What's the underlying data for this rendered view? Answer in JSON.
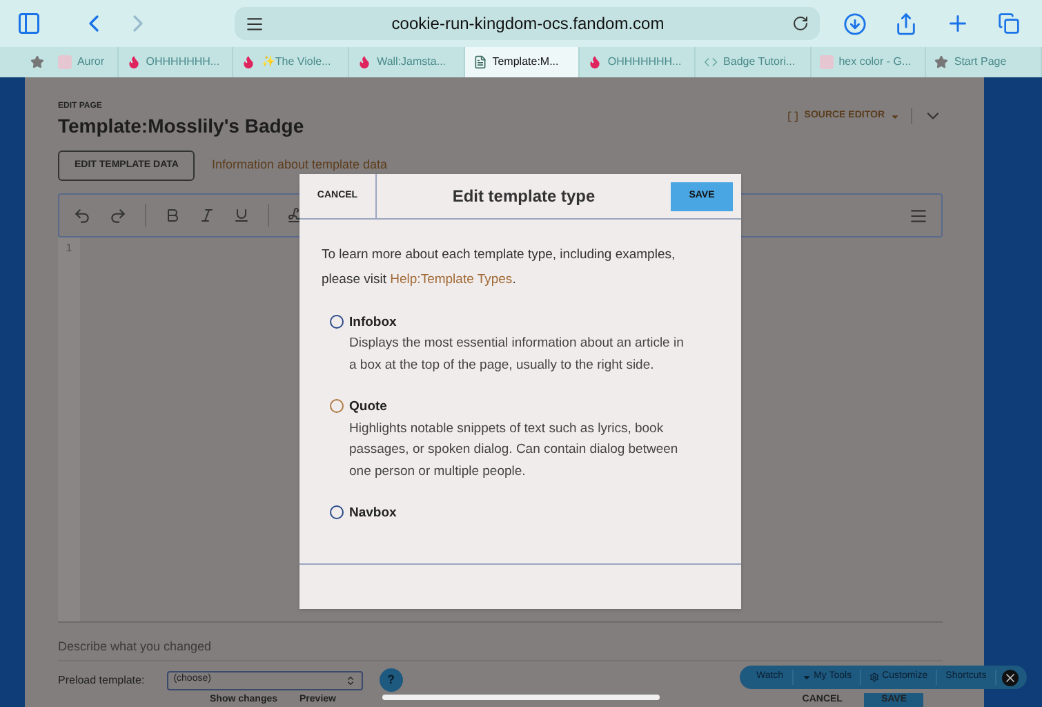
{
  "browser": {
    "url": "cookie-run-kingdom-ocs.fandom.com"
  },
  "tabs": [
    {
      "label": "Auror",
      "kind": "g",
      "selected": false
    },
    {
      "label": "OHHHHHHH...",
      "kind": "flame",
      "selected": false
    },
    {
      "label": "✨The Viole...",
      "kind": "flame",
      "selected": false
    },
    {
      "label": "Wall:Jamsta...",
      "kind": "flame",
      "selected": false
    },
    {
      "label": "Template:M...",
      "kind": "doc",
      "selected": true
    },
    {
      "label": "OHHHHHHH...",
      "kind": "flame",
      "selected": false
    },
    {
      "label": "Badge Tutori...",
      "kind": "code",
      "selected": false
    },
    {
      "label": "hex color - G...",
      "kind": "g",
      "selected": false
    },
    {
      "label": "Start Page",
      "kind": "star",
      "selected": false
    }
  ],
  "page": {
    "eyebrow": "EDIT PAGE",
    "title": "Template:Mosslily's Badge",
    "editor_mode": "SOURCE EDITOR",
    "edit_template_data": "EDIT TEMPLATE DATA",
    "template_data_link": "Information about template data",
    "line_number": "1",
    "summary_placeholder": "Describe what you changed",
    "preload_label": "Preload template:",
    "preload_value": "(choose)",
    "help": "?",
    "show_changes": "Show changes",
    "preview": "Preview",
    "cancel": "CANCEL",
    "save": "SAVE"
  },
  "toolbar": [
    "Watch",
    "My Tools",
    "Customize",
    "Shortcuts"
  ],
  "dialog": {
    "title": "Edit template type",
    "cancel": "CANCEL",
    "save": "SAVE",
    "intro": "To learn more about each template type, including examples, please visit",
    "link": "Help:Template Types",
    "intro_end": ".",
    "options": [
      {
        "label": "Infobox",
        "description": "Displays the most essential information about an article in a box at the top of the page, usually to the right side.",
        "selected": false,
        "color": "#2a4a8a"
      },
      {
        "label": "Quote",
        "description": "Highlights notable snippets of text such as lyrics, book passages, or spoken dialog. Can contain dialog between one person or multiple people.",
        "selected": false,
        "color": "#b07a45"
      },
      {
        "label": "Navbox",
        "selected": false,
        "color": "#2a4a8a"
      }
    ]
  }
}
